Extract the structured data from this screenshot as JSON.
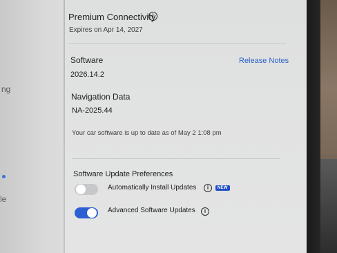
{
  "left_sidebar": {
    "fragments": [
      "ng",
      "le"
    ]
  },
  "connectivity": {
    "title": "Premium Connectivity",
    "expires": "Expires on Apr 14, 2027"
  },
  "software": {
    "label": "Software",
    "version": "2026.14.2",
    "release_notes_link": "Release Notes"
  },
  "navigation": {
    "label": "Navigation Data",
    "version": "NA-2025.44"
  },
  "status_message": "Your car software is up to date as of May 2 1:08 pm",
  "update_prefs": {
    "title": "Software Update Preferences",
    "auto_install": {
      "label": "Automatically Install Updates",
      "badge": "NEW",
      "enabled": false
    },
    "advanced": {
      "label": "Advanced Software Updates",
      "enabled": true
    }
  },
  "colors": {
    "accent": "#2c5fd2",
    "link": "#2b62c8",
    "badge": "#1f4fc7"
  }
}
